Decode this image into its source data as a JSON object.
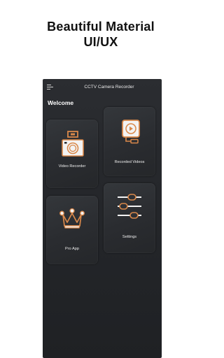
{
  "promo": {
    "line1": "Beautiful Material",
    "line2": "UI/UX"
  },
  "app": {
    "title": "CCTV Camera Recorder",
    "welcome": "Welcome",
    "cards": {
      "video_recorder": "Video Recorder",
      "recorded_videos": "Recorded Videos",
      "pro_app": "Pro App",
      "settings": "Settings"
    }
  },
  "colors": {
    "accent": "#d9884a",
    "background": "#25272b",
    "card": "#2f3135",
    "text": "#f0f0f0"
  },
  "icons": {
    "menu": "menu-icon",
    "video_recorder": "camera-icon",
    "recorded_videos": "video-file-icon",
    "pro_app": "crown-icon",
    "settings": "sliders-icon"
  }
}
